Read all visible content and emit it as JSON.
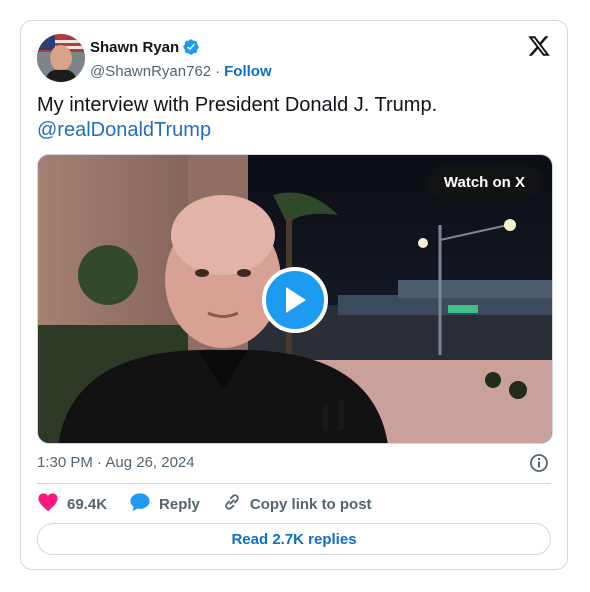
{
  "author": {
    "name": "Shawn Ryan",
    "handle": "@ShawnRyan762",
    "separator": "·",
    "follow_label": "Follow"
  },
  "tweet": {
    "text": "My interview with President Donald J. Trump.",
    "mention": "@realDonaldTrump"
  },
  "media": {
    "watch_label": "Watch on X"
  },
  "meta": {
    "timestamp": "1:30 PM · Aug 26, 2024"
  },
  "actions": {
    "likes": "69.4K",
    "reply_label": "Reply",
    "copy_label": "Copy link to post"
  },
  "read_replies": "Read 2.7K replies",
  "colors": {
    "accent": "#1d9bf0",
    "link": "#0f6ec5",
    "like": "#f91880",
    "border": "#cfd9de"
  },
  "icons": {
    "verified": "verified-badge-icon",
    "logo": "x-logo-icon",
    "info": "info-icon",
    "like": "heart-icon",
    "reply": "speech-bubble-icon",
    "copy": "link-icon",
    "play": "play-icon"
  }
}
